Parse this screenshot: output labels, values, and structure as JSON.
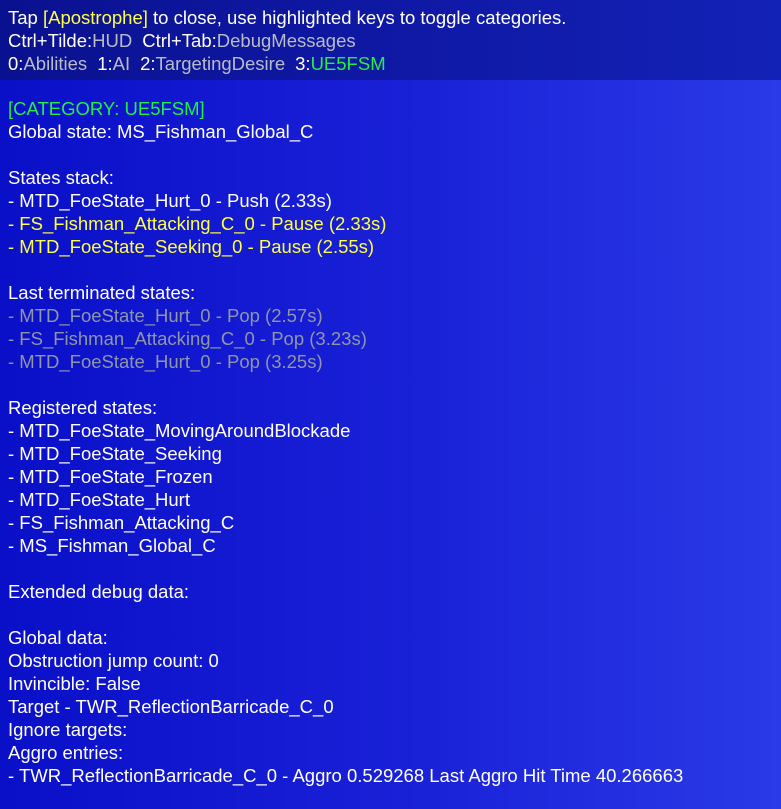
{
  "header": {
    "line1": {
      "prefix": "Tap ",
      "key": "[Apostrophe]",
      "suffix": " to close, use highlighted keys to toggle categories."
    },
    "line2": {
      "hud_key": "Ctrl+Tilde:",
      "hud_label": "HUD",
      "debug_key": "Ctrl+Tab:",
      "debug_label": "DebugMessages"
    },
    "categories": [
      {
        "key": "0:",
        "label": "Abilities"
      },
      {
        "key": "1:",
        "label": "AI"
      },
      {
        "key": "2:",
        "label": "TargetingDesire"
      },
      {
        "key": "3:",
        "label": "UE5FSM"
      }
    ]
  },
  "body": {
    "category_title": "[CATEGORY: UE5FSM]",
    "global_state": "Global state: MS_Fishman_Global_C",
    "states_stack_title": "States stack:",
    "states_stack": [
      "- MTD_FoeState_Hurt_0 - Push (2.33s)",
      "- FS_Fishman_Attacking_C_0 - Pause (2.33s)",
      "- MTD_FoeState_Seeking_0 - Pause (2.55s)"
    ],
    "last_terminated_title": "Last terminated states:",
    "last_terminated": [
      "- MTD_FoeState_Hurt_0 - Pop (2.57s)",
      "- FS_Fishman_Attacking_C_0 - Pop (3.23s)",
      "- MTD_FoeState_Hurt_0 - Pop (3.25s)"
    ],
    "registered_title": "Registered states:",
    "registered": [
      "- MTD_FoeState_MovingAroundBlockade",
      "- MTD_FoeState_Seeking",
      "- MTD_FoeState_Frozen",
      "- MTD_FoeState_Hurt",
      "- FS_Fishman_Attacking_C",
      "- MS_Fishman_Global_C"
    ],
    "extended_title": "Extended debug data:",
    "global_data_title": "Global data:",
    "global_data": [
      "Obstruction jump count: 0",
      "Invincible: False",
      "Target - TWR_ReflectionBarricade_C_0",
      "Ignore targets:",
      "Aggro entries:",
      "- TWR_ReflectionBarricade_C_0 - Aggro 0.529268 Last Aggro Hit Time 40.266663"
    ]
  },
  "colors": {
    "background": "#1a22d8",
    "header_bg": "#101aa8",
    "highlight_key": "#ffff44",
    "active_category": "#22ee44",
    "paused_state": "#ffff44",
    "terminated_state": "#8f96a8"
  }
}
